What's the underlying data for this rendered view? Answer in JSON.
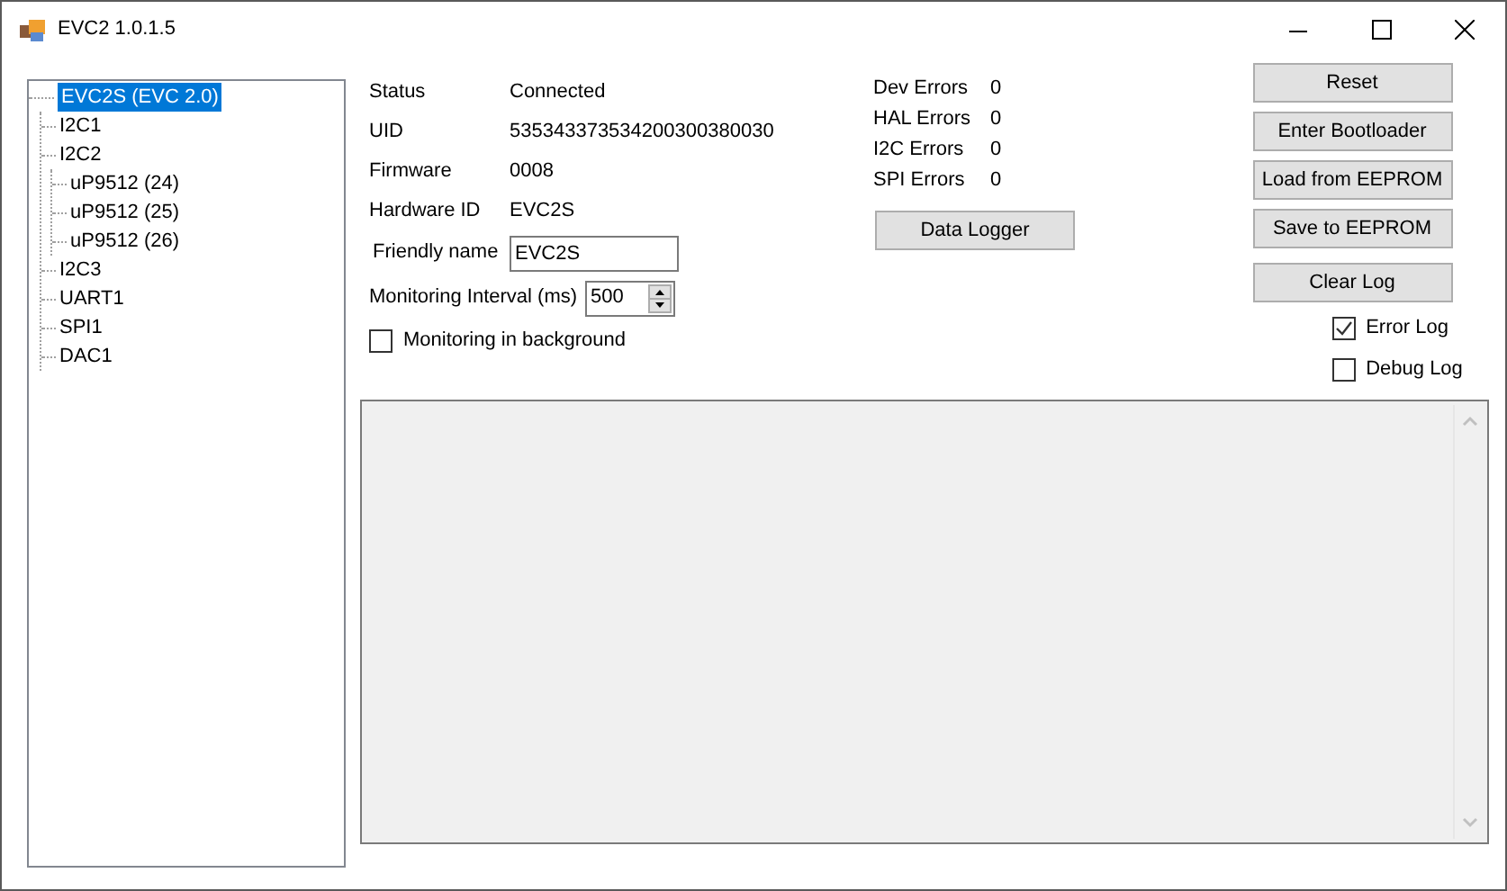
{
  "window": {
    "title": "EVC2 1.0.1.5"
  },
  "tree": [
    {
      "label": "EVC2S (EVC 2.0)",
      "selected": true,
      "children": [
        {
          "label": "I2C1",
          "selected": false
        },
        {
          "label": "I2C2",
          "selected": false,
          "children": [
            {
              "label": "uP9512 (24)",
              "selected": false
            },
            {
              "label": "uP9512 (25)",
              "selected": false
            },
            {
              "label": "uP9512 (26)",
              "selected": false
            }
          ]
        },
        {
          "label": "I2C3",
          "selected": false
        },
        {
          "label": "UART1",
          "selected": false
        },
        {
          "label": "SPI1",
          "selected": false
        },
        {
          "label": "DAC1",
          "selected": false
        }
      ]
    }
  ],
  "info": [
    {
      "kind": "text",
      "label": "Status",
      "value": "Connected"
    },
    {
      "kind": "text",
      "label": "UID",
      "value": "535343373534200300380030"
    },
    {
      "kind": "text",
      "label": "Firmware",
      "value": "0008"
    },
    {
      "kind": "text",
      "label": "Hardware ID",
      "value": "EVC2S"
    },
    {
      "kind": "field",
      "label": "Friendly name",
      "value": "EVC2S"
    },
    {
      "kind": "spinner",
      "label": "Monitoring Interval (ms)",
      "value": "500"
    },
    {
      "kind": "checkbox",
      "label": "Monitoring in background",
      "checked": false
    }
  ],
  "errors": [
    {
      "label": "Dev Errors",
      "value": "0"
    },
    {
      "label": "HAL Errors",
      "value": "0"
    },
    {
      "label": "I2C Errors",
      "value": "0"
    },
    {
      "label": "SPI Errors",
      "value": "0"
    }
  ],
  "data_logger_button": "Data Logger",
  "buttons": [
    "Reset",
    "Enter Bootloader",
    "Load from EEPROM",
    "Save to EEPROM",
    "Clear Log"
  ],
  "log_options": [
    {
      "label": "Error Log",
      "checked": true
    },
    {
      "label": "Debug Log",
      "checked": false
    }
  ]
}
